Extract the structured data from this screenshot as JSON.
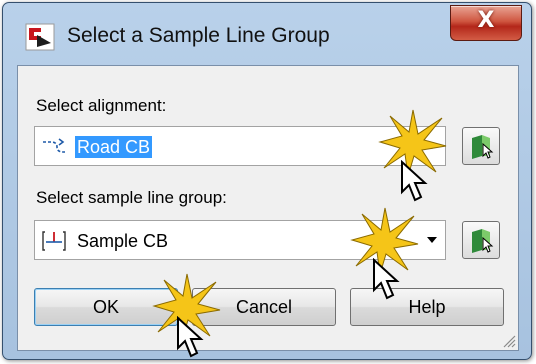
{
  "window": {
    "title": "Select a Sample Line Group",
    "close_glyph": "X",
    "app_icon": "civil3d-app-icon"
  },
  "alignment": {
    "label": "Select alignment:",
    "value": "Road CB",
    "icon": "alignment-icon",
    "pick_icon": "pick-from-drawing-icon"
  },
  "sample_line_group": {
    "label": "Select sample line group:",
    "value": "Sample CB",
    "icon": "sample-line-group-icon",
    "pick_icon": "pick-from-drawing-icon"
  },
  "buttons": {
    "ok": "OK",
    "cancel": "Cancel",
    "help": "Help"
  },
  "colors": {
    "title_bar": "#b9d1ea",
    "close_button": "#c94a36",
    "selection": "#3399ff",
    "client_bg": "#f0f0f0",
    "highlight_burst": "#f5c518"
  }
}
